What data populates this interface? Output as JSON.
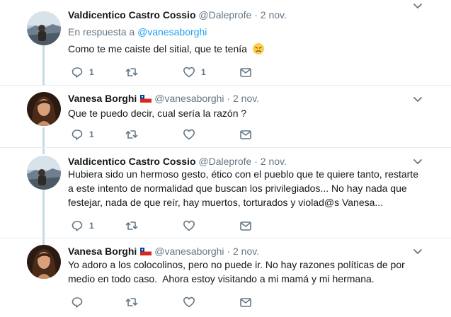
{
  "tweets": [
    {
      "author_name": "Valdicentico Castro Cossio",
      "handle": "@Daleprofe",
      "separator": "·",
      "time": "2 nov.",
      "reply_prefix": "En respuesta a",
      "reply_to": "@vanesaborghi",
      "text": "Como te me caiste del sitial, que te tenía",
      "emoji_icon": "disappointed-face-icon",
      "reply_count": "1",
      "retweet_count": "",
      "like_count": "1"
    },
    {
      "author_name": "Vanesa Borghi",
      "handle": "@vanesaborghi",
      "separator": "·",
      "time": "2 nov.",
      "flag_icon": "chile-flag-icon",
      "text": "Que te puedo decir, cual sería la razón ?",
      "reply_count": "1",
      "retweet_count": "",
      "like_count": ""
    },
    {
      "author_name": "Valdicentico Castro Cossio",
      "handle": "@Daleprofe",
      "separator": "·",
      "time": "2 nov.",
      "text_lines": [
        "Hubiera sido un hermoso gesto, ético con el pueblo que te quiere tanto, restarte",
        "a este intento de normalidad que buscan los privilegiados... No hay nada que",
        "festejar, nada de que reír, hay muertos, torturados y violad@s Vanesa..."
      ],
      "reply_count": "1",
      "retweet_count": "",
      "like_count": ""
    },
    {
      "author_name": "Vanesa Borghi",
      "handle": "@vanesaborghi",
      "separator": "·",
      "time": "2 nov.",
      "flag_icon": "chile-flag-icon",
      "text_lines": [
        "Yo adoro a los colocolinos, pero no puede ir. No hay razones políticas de por",
        "medio en todo caso.  Ahora estoy visitando a mi mamá y mi hermana."
      ],
      "reply_count": "",
      "retweet_count": "",
      "like_count": ""
    }
  ],
  "colors": {
    "text": "#14171a",
    "muted": "#657786",
    "link": "#1da1f2",
    "thread_line": "#c4d9e6",
    "divider": "#e6ecf0"
  }
}
